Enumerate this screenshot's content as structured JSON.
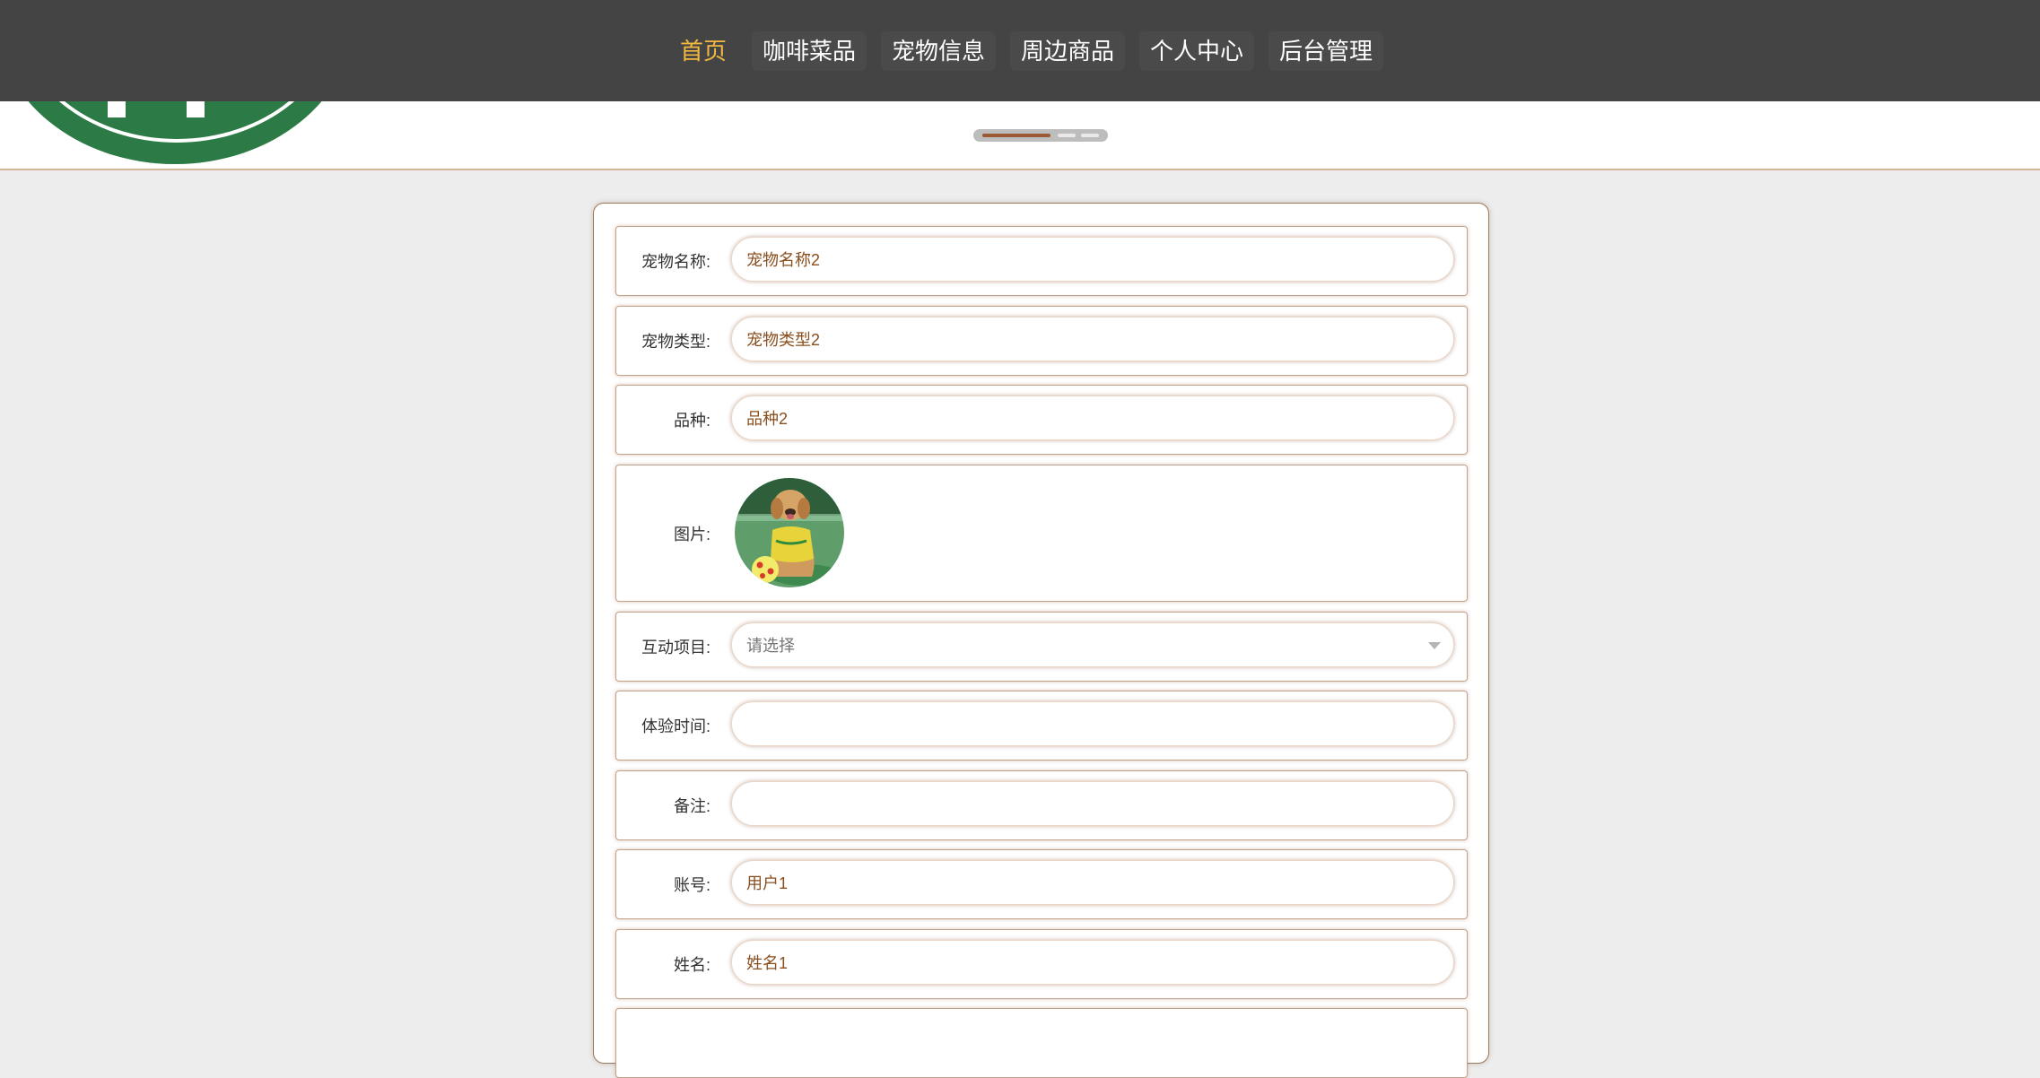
{
  "nav": {
    "items": [
      {
        "label": "首页",
        "active": true
      },
      {
        "label": "咖啡菜品",
        "active": false
      },
      {
        "label": "宠物信息",
        "active": false
      },
      {
        "label": "周边商品",
        "active": false
      },
      {
        "label": "个人中心",
        "active": false
      },
      {
        "label": "后台管理",
        "active": false
      }
    ],
    "active_color": "#f2b940",
    "bg_color": "#444444"
  },
  "banner": {
    "slides_count": 3,
    "active_slide": 1,
    "logo_icon": "coffee-logo-icon"
  },
  "form": {
    "pet_name": {
      "label": "宠物名称:",
      "value": "宠物名称2"
    },
    "pet_type": {
      "label": "宠物类型:",
      "value": "宠物类型2"
    },
    "breed": {
      "label": "品种:",
      "value": "品种2"
    },
    "image": {
      "label": "图片:",
      "icon": "pet-photo-dog"
    },
    "activity": {
      "label": "互动项目:",
      "placeholder": "请选择"
    },
    "experience_time": {
      "label": "体验时间:",
      "value": ""
    },
    "remarks": {
      "label": "备注:",
      "value": ""
    },
    "account": {
      "label": "账号:",
      "value": "用户1"
    },
    "name": {
      "label": "姓名:",
      "value": "姓名1"
    }
  },
  "colors": {
    "accent_brown": "#8a4f1f",
    "border_brown": "#c4a289",
    "page_bg": "#ededed"
  }
}
